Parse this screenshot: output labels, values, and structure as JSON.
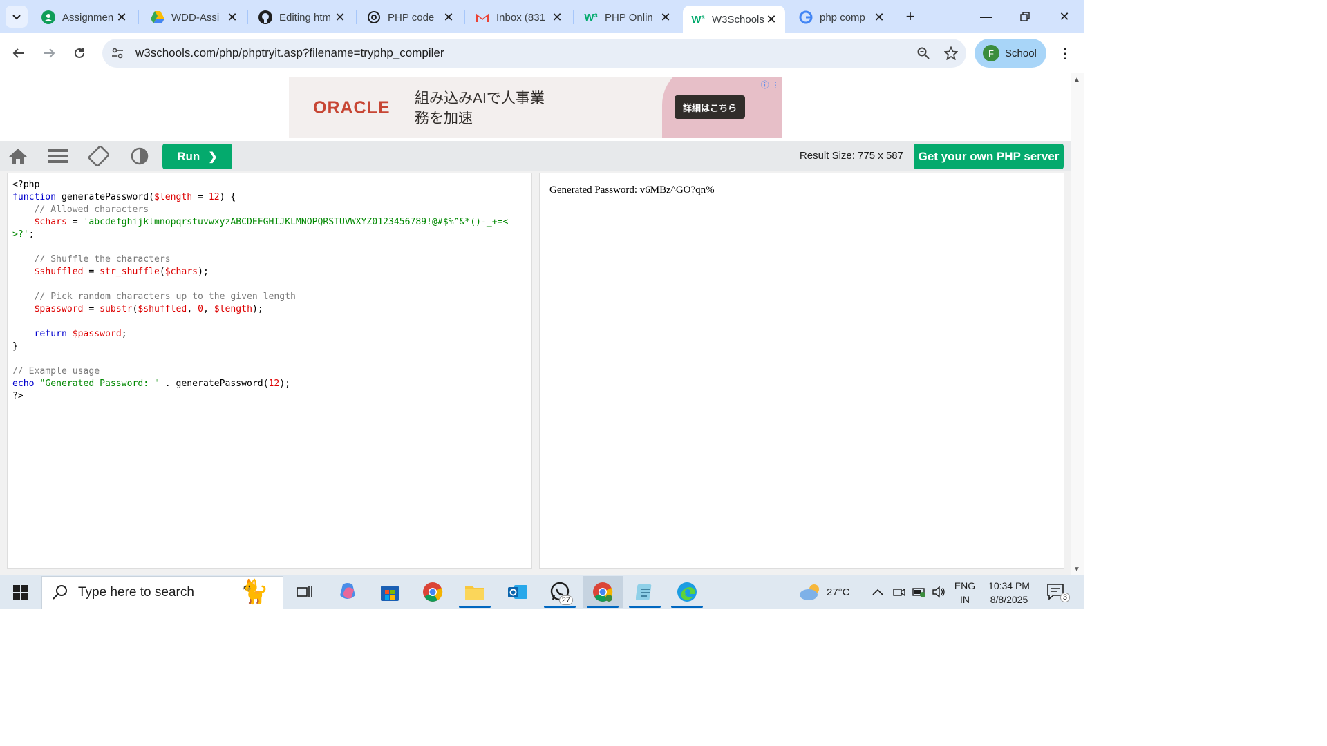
{
  "browser": {
    "tabs": [
      {
        "title": "Assignmen",
        "icon": "classroom-icon"
      },
      {
        "title": "WDD-Assi",
        "icon": "drive-icon"
      },
      {
        "title": "Editing htm",
        "icon": "github-icon"
      },
      {
        "title": "PHP code",
        "icon": "chatgpt-icon"
      },
      {
        "title": "Inbox (831",
        "icon": "gmail-icon"
      },
      {
        "title": "PHP Onlin",
        "icon": "w3schools-icon"
      },
      {
        "title": "W3Schools",
        "icon": "w3schools-icon"
      },
      {
        "title": "php comp",
        "icon": "google-icon"
      }
    ],
    "active_tab_index": 6,
    "url": "w3schools.com/php/phptryit.asp?filename=tryphp_compiler",
    "profile_initial": "F",
    "profile_name": "School"
  },
  "ad": {
    "brand": "ORACLE",
    "headline": "組み込みAIで人事業務を加速",
    "cta": "詳細はこちら"
  },
  "tryit": {
    "run_label": "Run",
    "result_size": "Result Size: 775 x 587",
    "get_server_label": "Get your own PHP server"
  },
  "editor": {
    "code_lines": [
      "<?php",
      "function generatePassword($length = 12) {",
      "    // Allowed characters",
      "    $chars = 'abcdefghijklmnopqrstuvwxyzABCDEFGHIJKLMNOPQRSTUVWXYZ0123456789!@#$%^&*()-_+=<>?';",
      "",
      "    // Shuffle the characters",
      "    $shuffled = str_shuffle($chars);",
      "",
      "    // Pick random characters up to the given length",
      "    $password = substr($shuffled, 0, $length);",
      "",
      "    return $password;",
      "}",
      "",
      "// Example usage",
      "echo \"Generated Password: \" . generatePassword(12);",
      "?>"
    ]
  },
  "result": {
    "output": "Generated Password: v6MBz^GO?qn%"
  },
  "taskbar": {
    "search_placeholder": "Type here to search",
    "whatsapp_badge": "27",
    "weather": "27°C",
    "lang_top": "ENG",
    "lang_bottom": "IN",
    "time": "10:34 PM",
    "date": "8/8/2025",
    "notifications": "3"
  },
  "colors": {
    "w3_green": "#04aa6d",
    "tabbar_bg": "#d3e3fd",
    "oracle_red": "#c74634"
  }
}
